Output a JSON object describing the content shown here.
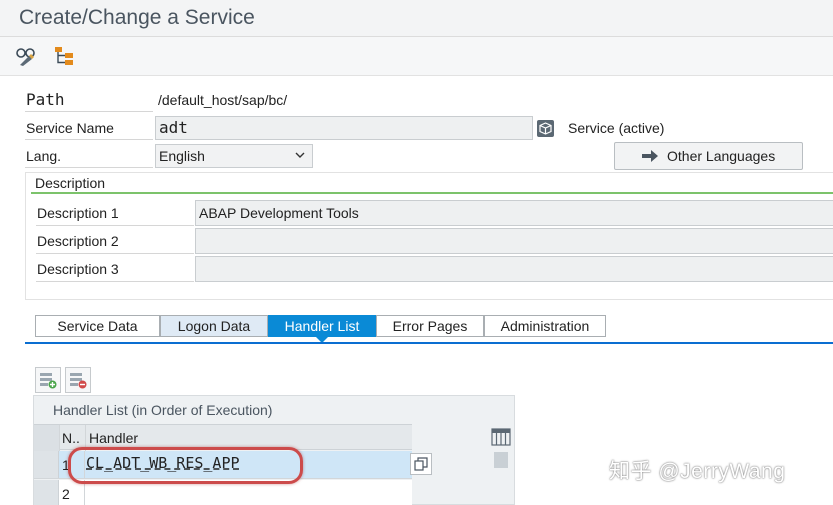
{
  "window": {
    "title": "Create/Change a Service"
  },
  "toolbar": {
    "icons": [
      "display-change-icon",
      "hierarchy-icon"
    ]
  },
  "form": {
    "path_label": "Path",
    "path_value": "/default_host/sap/bc/",
    "service_name_label": "Service Name",
    "service_name_value": "adt",
    "service_status": "Service (active)",
    "lang_label": "Lang.",
    "lang_value": "English",
    "other_languages_label": "Other Languages"
  },
  "description": {
    "section_label": "Description",
    "rows": [
      {
        "label": "Description 1",
        "value": "ABAP Development Tools"
      },
      {
        "label": "Description 2",
        "value": ""
      },
      {
        "label": "Description 3",
        "value": ""
      }
    ]
  },
  "tabs": [
    {
      "label": "Service Data",
      "state": "normal"
    },
    {
      "label": "Logon Data",
      "state": "alt"
    },
    {
      "label": "Handler List",
      "state": "active"
    },
    {
      "label": "Error Pages",
      "state": "normal"
    },
    {
      "label": "Administration",
      "state": "normal"
    }
  ],
  "handler_list": {
    "title": "Handler List (in Order of Execution)",
    "col_num": "N..",
    "col_handler": "Handler",
    "rows": [
      {
        "num": "1",
        "handler": "CL_ADT_WB_RES_APP"
      },
      {
        "num": "2",
        "handler": ""
      }
    ]
  },
  "watermark": "知乎 @JerryWang",
  "colors": {
    "accent": "#0a8ad6",
    "desc_underline": "#7cc36b",
    "callout": "#cc4b4b"
  }
}
